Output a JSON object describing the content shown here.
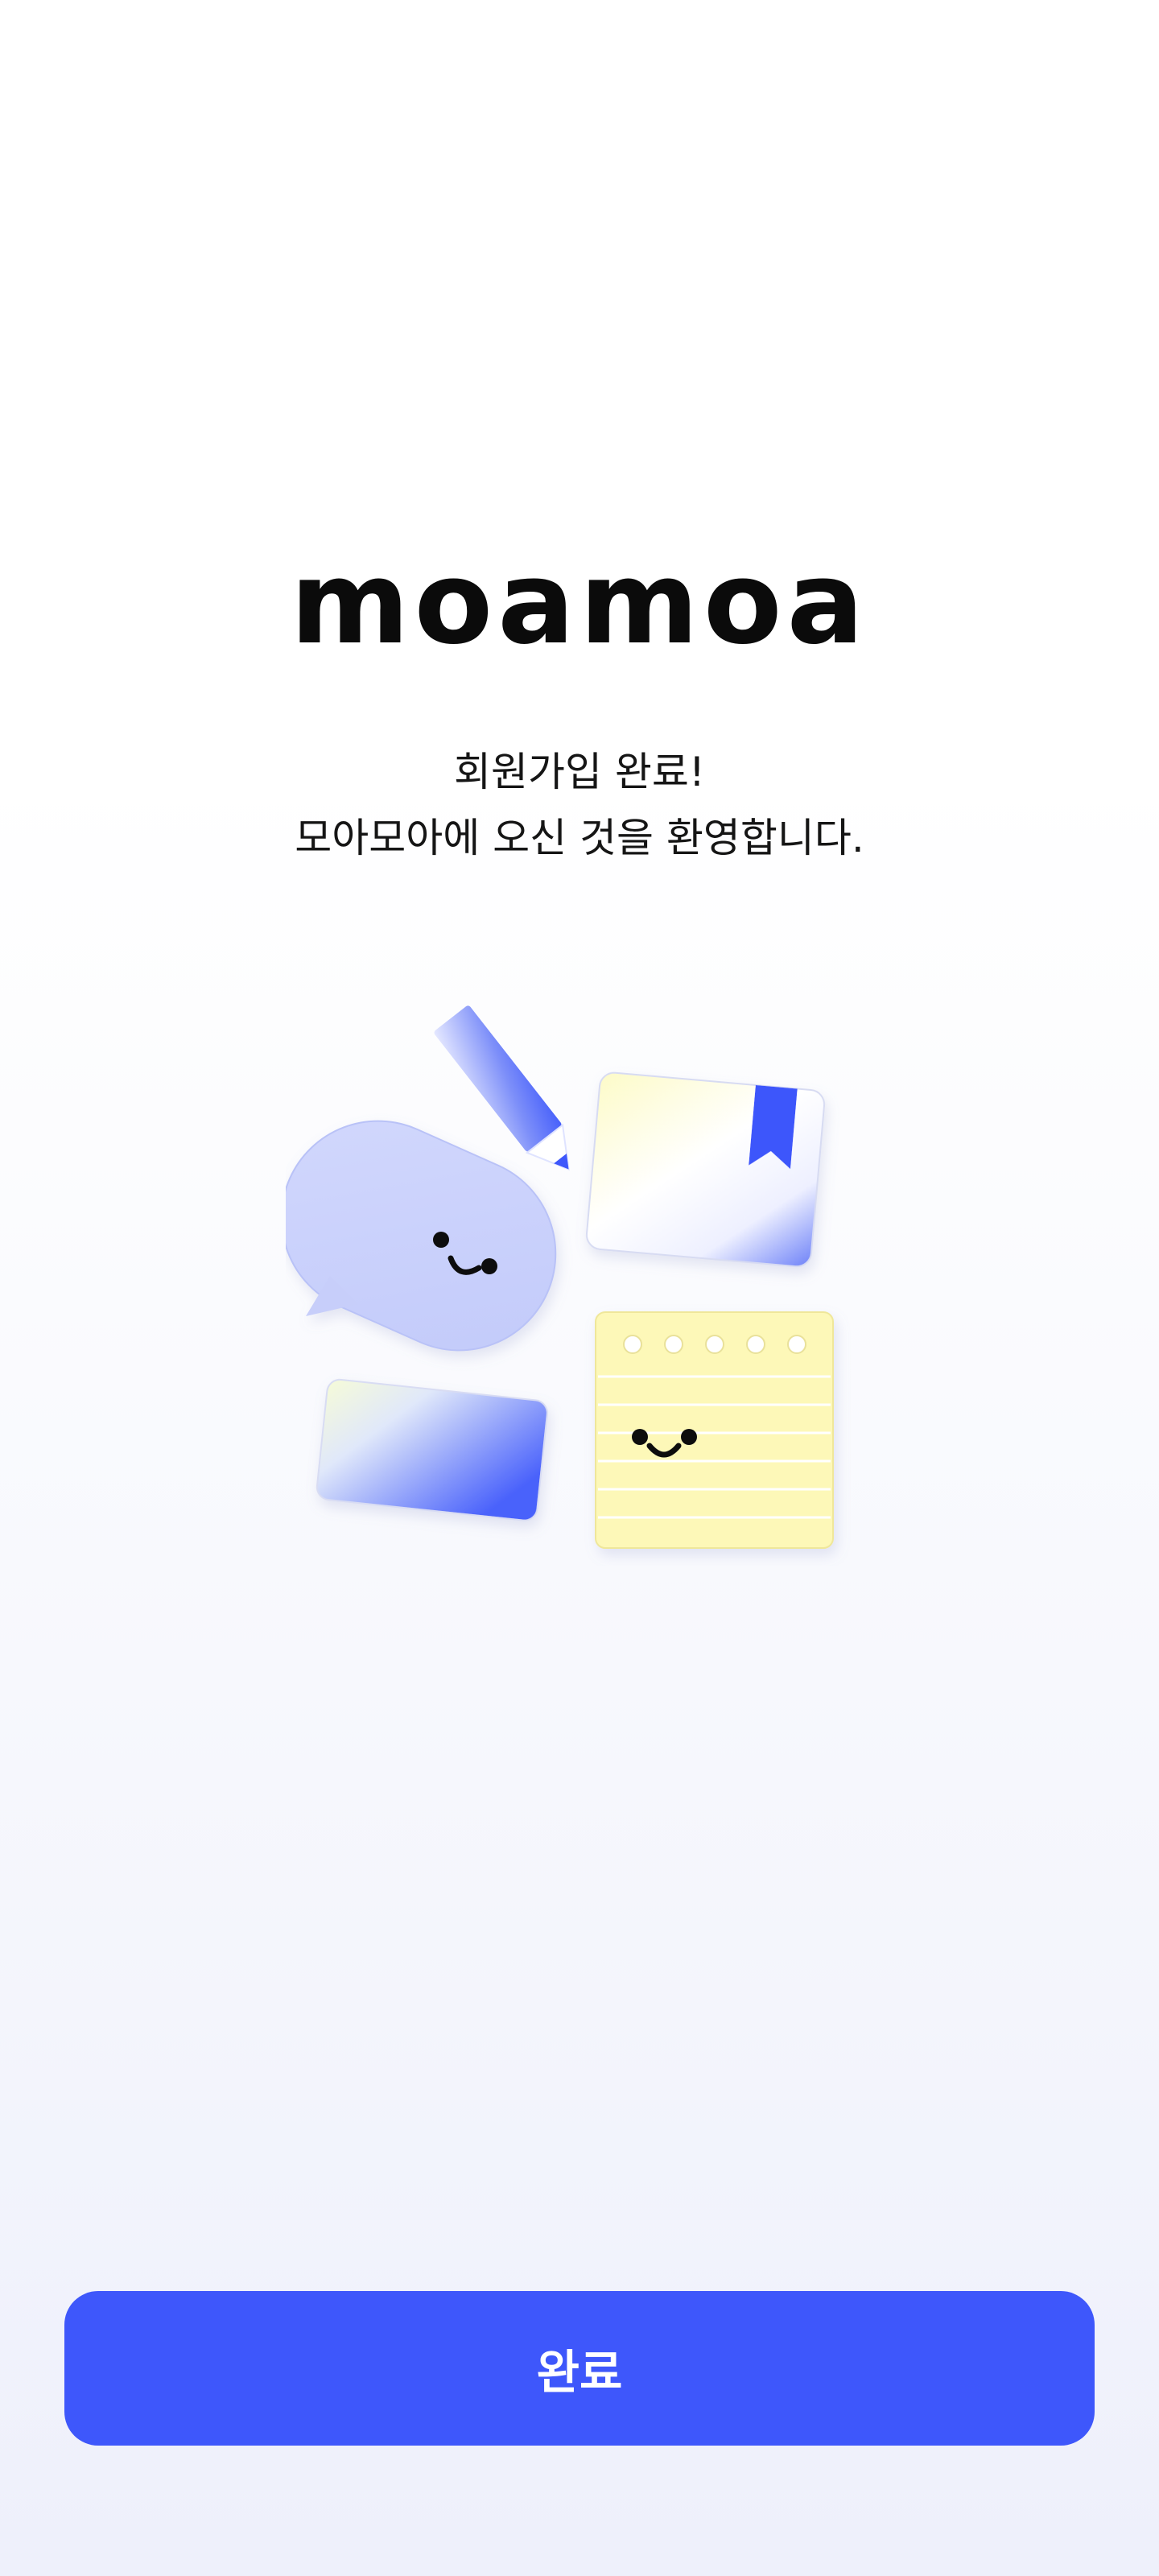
{
  "brand": {
    "logo_text": "moamoa"
  },
  "welcome": {
    "line1": "회원가입 완료!",
    "line2": "모아모아에 오신 것을 환영합니다."
  },
  "illustration": {
    "items": [
      "pencil-icon",
      "speech-bubble-icon",
      "bookmarked-card-icon",
      "gradient-card-icon",
      "notepad-icon"
    ]
  },
  "actions": {
    "complete_label": "완료"
  },
  "colors": {
    "accent": "#3e57fb",
    "background": "#ffffff",
    "bubble": "#c9d0fb",
    "note_yellow": "#fdf8b8"
  }
}
